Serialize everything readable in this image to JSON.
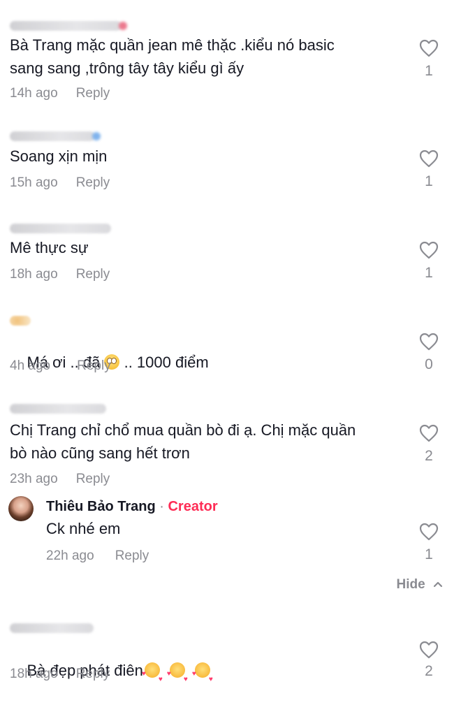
{
  "comments": [
    {
      "text": "Bà Trang mặc quần jean mê thặc .kiểu nó basic\nsang sang ,trông tây tây kiểu gì ấy",
      "time": "14h ago",
      "reply_label": "Reply",
      "likes": "1"
    },
    {
      "text": "Soang xịn mịn",
      "time": "15h ago",
      "reply_label": "Reply",
      "likes": "1"
    },
    {
      "text": "Mê thực sự",
      "time": "18h ago",
      "reply_label": "Reply",
      "likes": "1"
    },
    {
      "text_before": "Má ơi .. đã ",
      "emoji": "face-with-rolling-eyes",
      "text_after": " .. 1000 điểm",
      "time": "4h ago",
      "reply_label": "Reply",
      "likes": "0"
    },
    {
      "text": "Chị Trang chỉ chổ mua quần bò đi ạ. Chị mặc quần\nbò nào cũng sang hết trơn",
      "time": "23h ago",
      "reply_label": "Reply",
      "likes": "2"
    },
    {
      "text": "Bà đẹp phát điên",
      "emoji": "smiling-face-with-hearts",
      "time": "18h ago",
      "reply_label": "Reply",
      "likes": "2"
    }
  ],
  "creator_reply": {
    "name": "Thiêu Bảo Trang",
    "separator": "·",
    "badge": "Creator",
    "text": "Ck nhé em",
    "time": "22h ago",
    "reply_label": "Reply",
    "likes": "1"
  },
  "hide_label": "Hide",
  "colors": {
    "text": "#161823",
    "secondary": "#8a8b91",
    "creator_badge": "#fe2c55",
    "background": "#ffffff"
  },
  "icons": {
    "like": "heart-outline-icon",
    "collapse": "chevron-up-icon"
  }
}
